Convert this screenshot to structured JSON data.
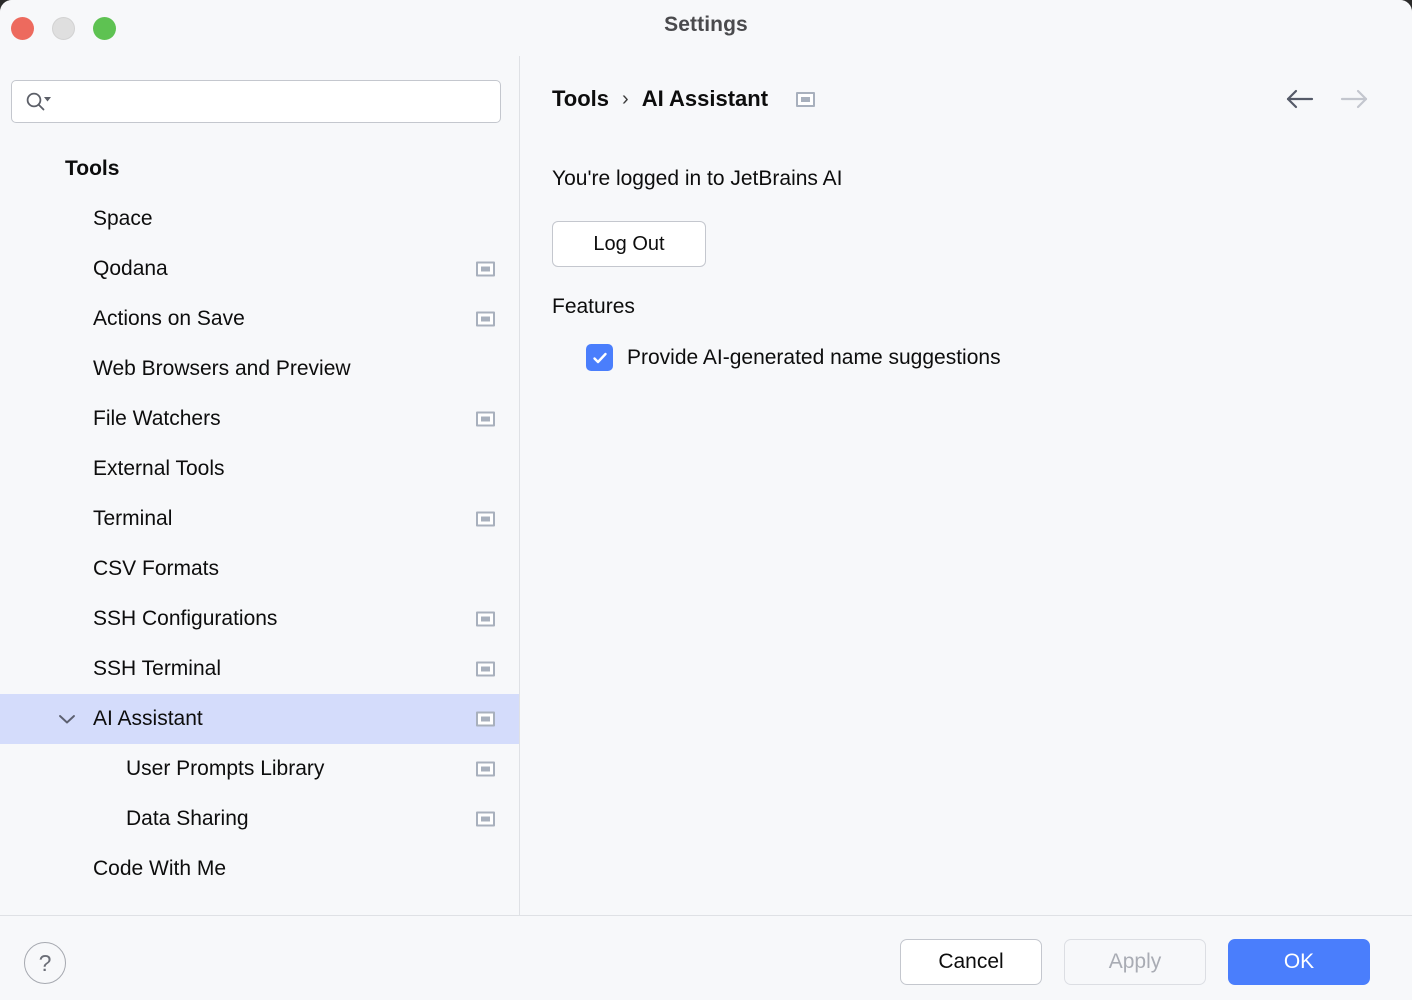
{
  "window": {
    "title": "Settings",
    "traffic_lights": [
      "close-button",
      "minimize-button",
      "maximize-button"
    ]
  },
  "search": {
    "value": "",
    "placeholder": "",
    "icon": "search-icon-with-dropdown"
  },
  "sidebar": {
    "items": [
      {
        "label": "Tools",
        "level": 0,
        "group": true,
        "badge": false,
        "selected": false,
        "chevron": ""
      },
      {
        "label": "Space",
        "level": 1,
        "group": false,
        "badge": false,
        "selected": false,
        "chevron": ""
      },
      {
        "label": "Qodana",
        "level": 1,
        "group": false,
        "badge": true,
        "selected": false,
        "chevron": ""
      },
      {
        "label": "Actions on Save",
        "level": 1,
        "group": false,
        "badge": true,
        "selected": false,
        "chevron": ""
      },
      {
        "label": "Web Browsers and Preview",
        "level": 1,
        "group": false,
        "badge": false,
        "selected": false,
        "chevron": ""
      },
      {
        "label": "File Watchers",
        "level": 1,
        "group": false,
        "badge": true,
        "selected": false,
        "chevron": ""
      },
      {
        "label": "External Tools",
        "level": 1,
        "group": false,
        "badge": false,
        "selected": false,
        "chevron": ""
      },
      {
        "label": "Terminal",
        "level": 1,
        "group": false,
        "badge": true,
        "selected": false,
        "chevron": ""
      },
      {
        "label": "CSV Formats",
        "level": 1,
        "group": false,
        "badge": false,
        "selected": false,
        "chevron": ""
      },
      {
        "label": "SSH Configurations",
        "level": 1,
        "group": false,
        "badge": true,
        "selected": false,
        "chevron": ""
      },
      {
        "label": "SSH Terminal",
        "level": 1,
        "group": false,
        "badge": true,
        "selected": false,
        "chevron": ""
      },
      {
        "label": "AI Assistant",
        "level": 1,
        "group": false,
        "badge": true,
        "selected": true,
        "chevron": "chevron-down-icon"
      },
      {
        "label": "User Prompts Library",
        "level": 2,
        "group": false,
        "badge": true,
        "selected": false,
        "chevron": ""
      },
      {
        "label": "Data Sharing",
        "level": 2,
        "group": false,
        "badge": true,
        "selected": false,
        "chevron": ""
      },
      {
        "label": "Code With Me",
        "level": 1,
        "group": false,
        "badge": false,
        "selected": false,
        "chevron": ""
      }
    ]
  },
  "main": {
    "breadcrumb": {
      "root": "Tools",
      "separator": "›",
      "current": "AI Assistant",
      "badge": true
    },
    "nav": {
      "back_enabled": true,
      "forward_enabled": false
    },
    "login_status": "You're logged in to JetBrains AI",
    "logout_label": "Log Out",
    "features_title": "Features",
    "feature_checkbox": {
      "label": "Provide AI-generated name suggestions",
      "checked": true
    }
  },
  "footer": {
    "help_label": "?",
    "cancel_label": "Cancel",
    "apply_label": "Apply",
    "apply_enabled": false,
    "ok_label": "OK"
  },
  "colors": {
    "accent": "#4a7efc",
    "selection": "#d4dcfb",
    "background": "#f7f8fa",
    "divider": "#dfe1e5",
    "badge": "#a8b0bd",
    "traffic_close": "#ed6a5e",
    "traffic_min": "#dfdfdf",
    "traffic_max": "#5ec252"
  }
}
